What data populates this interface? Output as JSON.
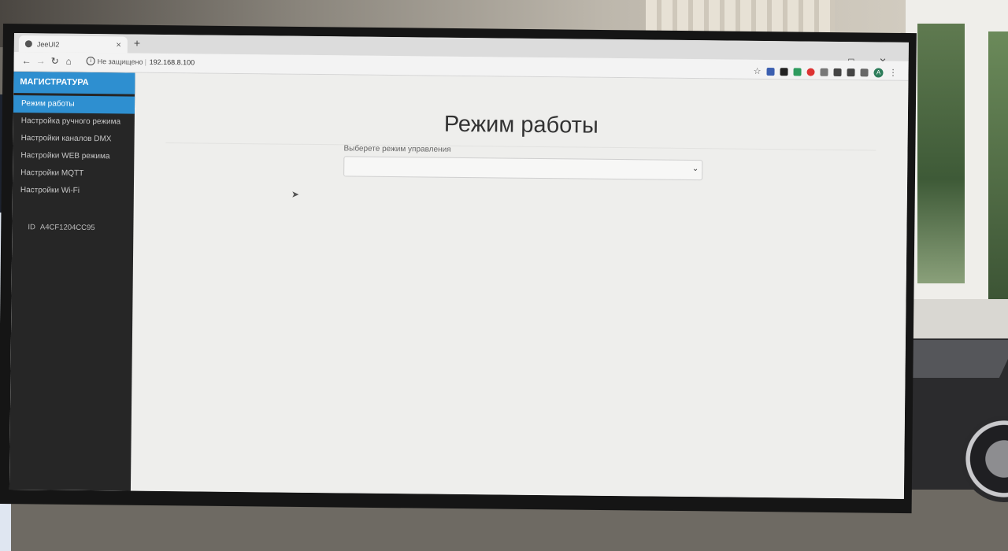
{
  "browser": {
    "tab_title": "JeeUI2",
    "new_tab": "+",
    "window_controls": "– ◻ ✕",
    "security_label": "Не защищено",
    "url": "192.168.8.100",
    "avatar_letter": "A"
  },
  "sidebar": {
    "brand": "МАГИСТРАТУРА",
    "items": [
      {
        "label": "Режим работы",
        "active": true
      },
      {
        "label": "Настройка ручного режима"
      },
      {
        "label": "Настройки каналов DMX"
      },
      {
        "label": "Настройки WEB режима"
      },
      {
        "label": "Настройки MQTT"
      },
      {
        "label": "Настройки Wi-Fi"
      }
    ],
    "device_id_label": "ID",
    "device_id_value": "A4CF1204CC95"
  },
  "main": {
    "title": "Режим работы",
    "select_label": "Выберете режим управления",
    "select_value": ""
  },
  "colors": {
    "accent": "#2e8fd0",
    "sidebar_bg": "#262626",
    "page_bg": "#eeeeec"
  }
}
